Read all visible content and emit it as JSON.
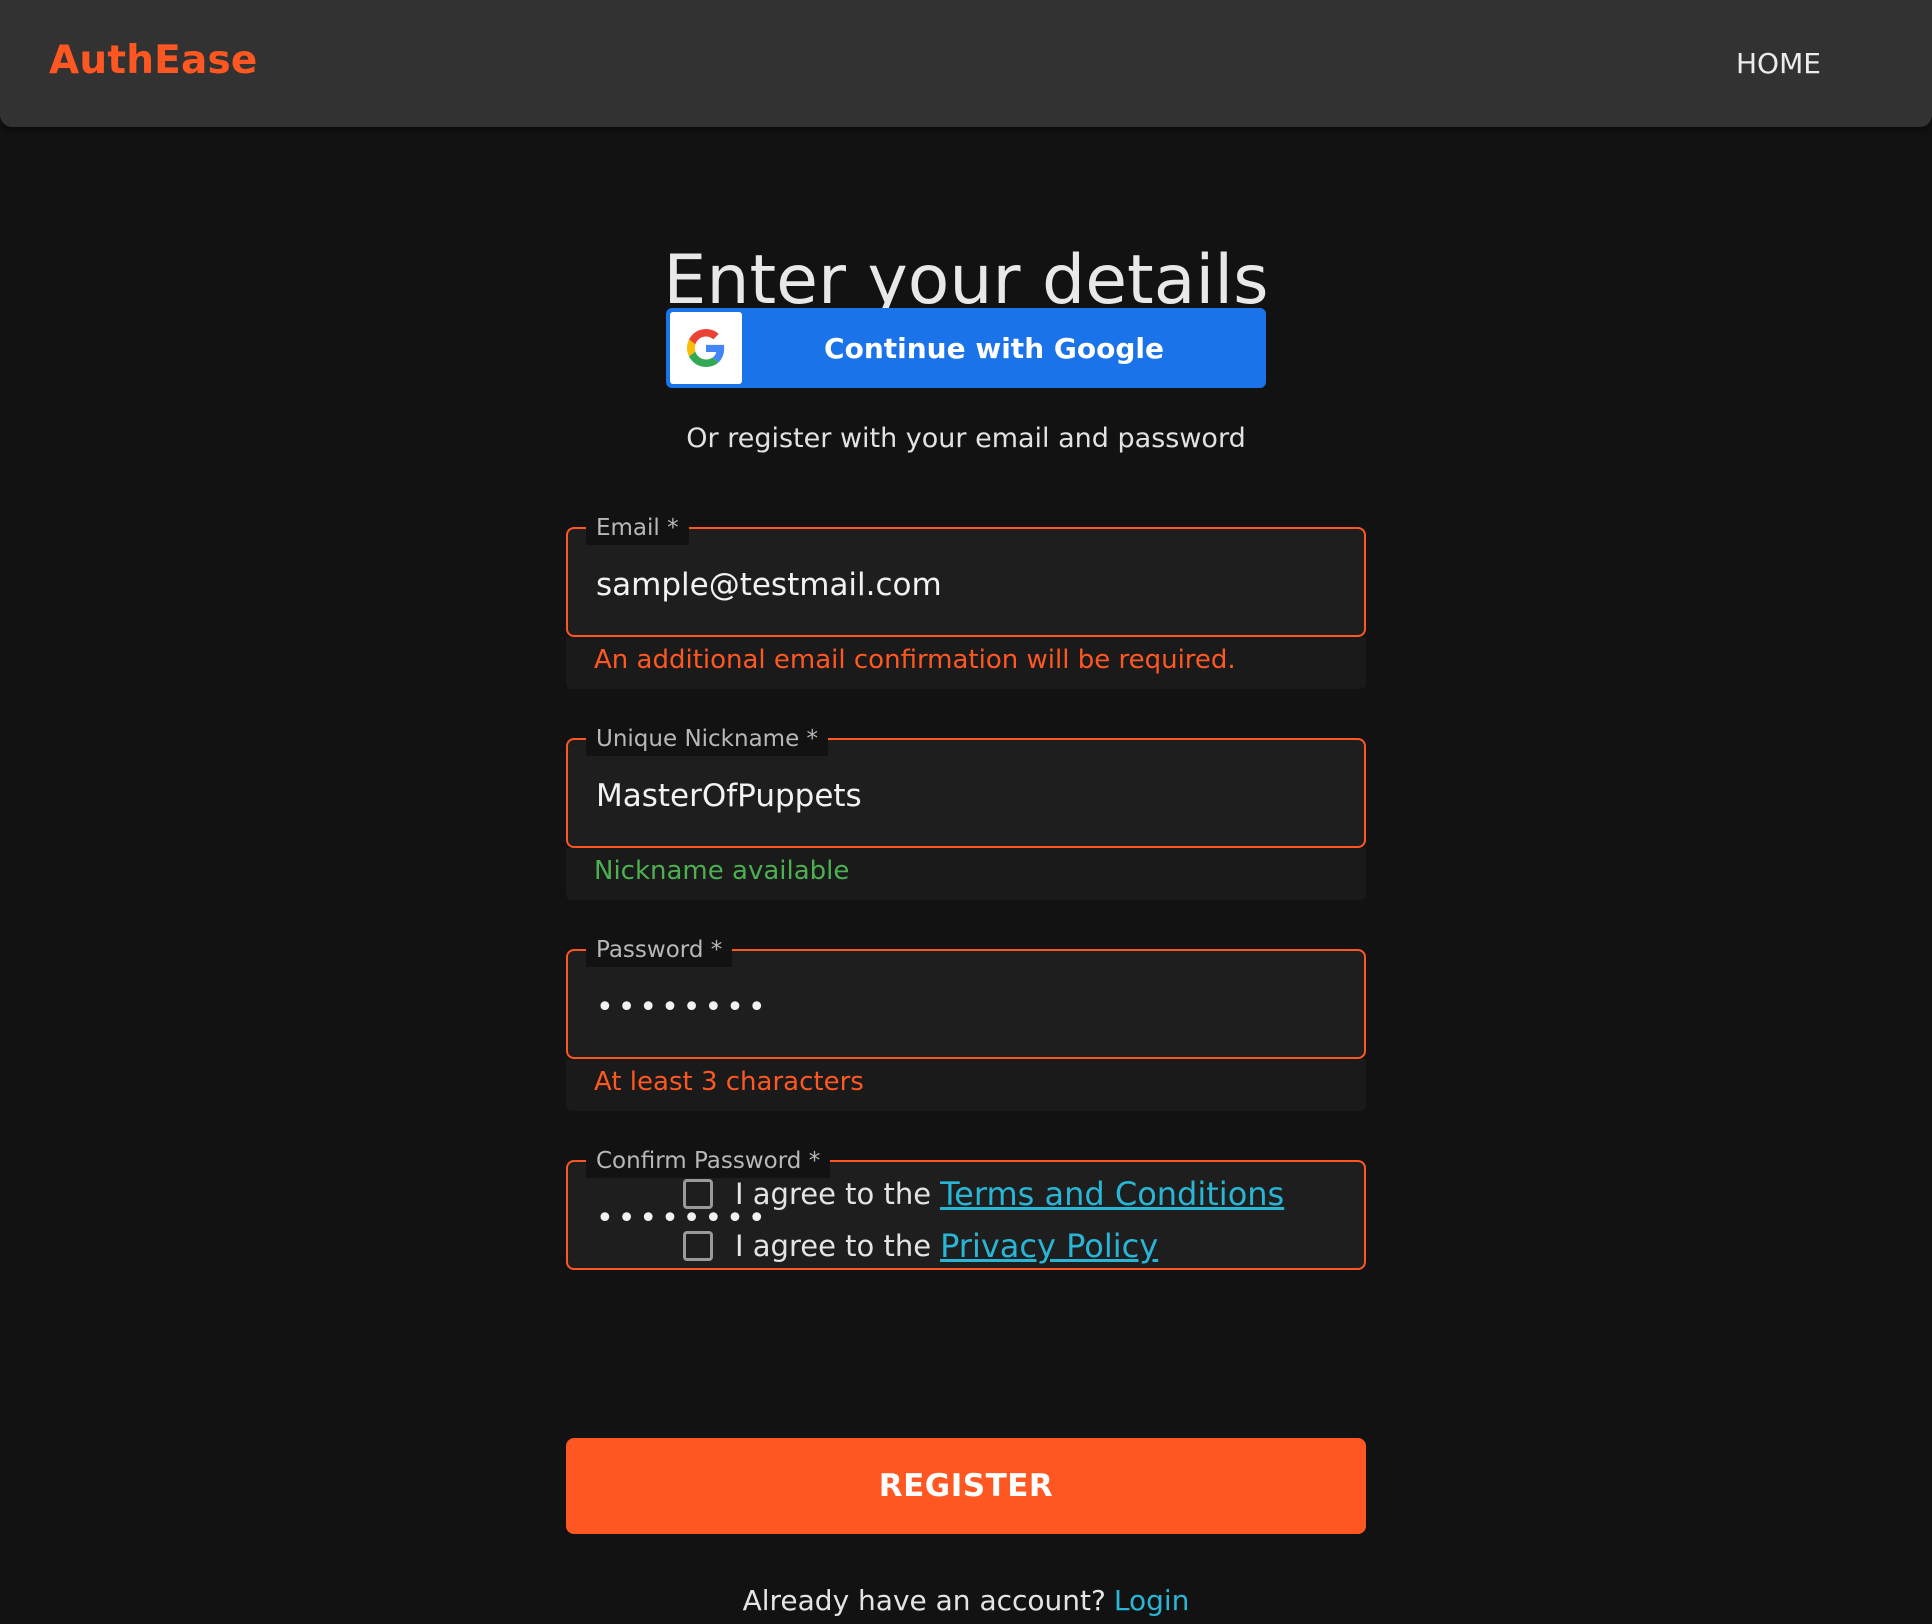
{
  "app": {
    "brand": "AuthEase",
    "nav_home": "HOME"
  },
  "page": {
    "title": "Enter your details",
    "google_button_label": "Continue with Google",
    "or_text": "Or register with your email and password"
  },
  "form": {
    "email": {
      "label": "Email *",
      "value": "sample@testmail.com",
      "helper": "An additional email confirmation will be required."
    },
    "nickname": {
      "label": "Unique Nickname *",
      "value": "MasterOfPuppets",
      "helper": "Nickname available"
    },
    "password": {
      "label": "Password *",
      "value": "••••••••",
      "helper": "At least 3 characters"
    },
    "confirm_password": {
      "label": "Confirm Password *",
      "value": "••••••••"
    },
    "agree_prefix": "I agree to the",
    "terms_link": "Terms and Conditions",
    "privacy_link": "Privacy Policy",
    "register_label": "REGISTER",
    "login_prompt": "Already have an account?",
    "login_link": "Login"
  },
  "colors": {
    "accent": "#ff5722",
    "success": "#4caf50",
    "link": "#29b6d6",
    "google_blue": "#1a73e8"
  },
  "icons": {
    "google": "google-g-icon"
  }
}
